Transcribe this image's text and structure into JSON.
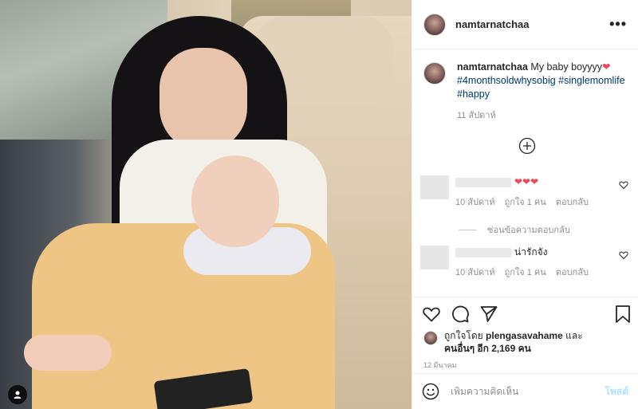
{
  "post": {
    "username": "namtarnatchaa",
    "more_icon": "more-horizontal-icon"
  },
  "caption": {
    "username": "namtarnatchaa",
    "text": "My baby boyyyy",
    "emoji": "❤",
    "hashtags_line1": "#4monthsoldwhysobig #singlemomlife",
    "hashtags_line2": "#happy",
    "time": "11 สัปดาห์"
  },
  "comments": [
    {
      "text": "❤❤❤",
      "time": "10 สัปดาห์",
      "likes": "ถูกใจ 1 คน",
      "reply": "ตอบกลับ"
    },
    {
      "text": "น่ารักจัง",
      "time": "10 สัปดาห์",
      "likes": "ถูกใจ 1 คน",
      "reply": "ตอบกลับ"
    }
  ],
  "hide_replies": "ซ่อนข้อความตอบกลับ",
  "likes": {
    "prefix": "ถูกใจโดย",
    "first_user": "plengasavahame",
    "and": "และ",
    "others": "คนอื่นๆ อีก 2,169 คน"
  },
  "date": "12 มีนาคม",
  "compose": {
    "placeholder": "เพิ่มความคิดเห็น",
    "post_label": "โพสต์"
  },
  "colors": {
    "accent_link": "#00376b",
    "heart": "#ed4956",
    "post_disabled": "#b2dffc"
  }
}
